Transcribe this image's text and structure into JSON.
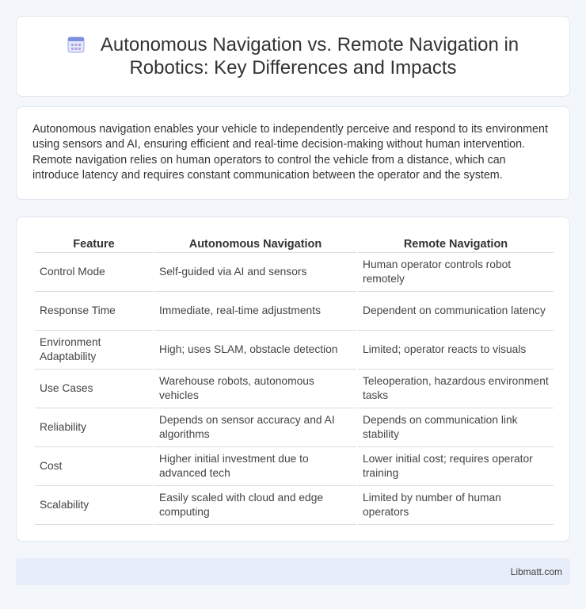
{
  "header": {
    "title": "Autonomous Navigation vs. Remote Navigation in Robotics: Key Differences and Impacts",
    "icon": "calendar-icon"
  },
  "intro": {
    "text": "Autonomous navigation enables your vehicle to independently perceive and respond to its environment using sensors and AI, ensuring efficient and real-time decision-making without human intervention. Remote navigation relies on human operators to control the vehicle from a distance, which can introduce latency and requires constant communication between the operator and the system."
  },
  "table": {
    "headers": [
      "Feature",
      "Autonomous Navigation",
      "Remote Navigation"
    ],
    "rows": [
      [
        "Control Mode",
        "Self-guided via AI and sensors",
        "Human operator controls robot remotely"
      ],
      [
        "Response Time",
        "Immediate, real-time adjustments",
        "Dependent on communication latency"
      ],
      [
        "Environment Adaptability",
        "High; uses SLAM, obstacle detection",
        "Limited; operator reacts to visuals"
      ],
      [
        "Use Cases",
        "Warehouse robots, autonomous vehicles",
        "Teleoperation, hazardous environment tasks"
      ],
      [
        "Reliability",
        "Depends on sensor accuracy and AI algorithms",
        "Depends on communication link stability"
      ],
      [
        "Cost",
        "Higher initial investment due to advanced tech",
        "Lower initial cost; requires operator training"
      ],
      [
        "Scalability",
        "Easily scaled with cloud and edge computing",
        "Limited by number of human operators"
      ]
    ]
  },
  "footer": {
    "text": "Libmatt.com"
  },
  "colors": {
    "background": "#f3f6fb",
    "card": "#ffffff",
    "footer_bg": "#e8eef9",
    "icon_accent": "#7b8fe0"
  }
}
